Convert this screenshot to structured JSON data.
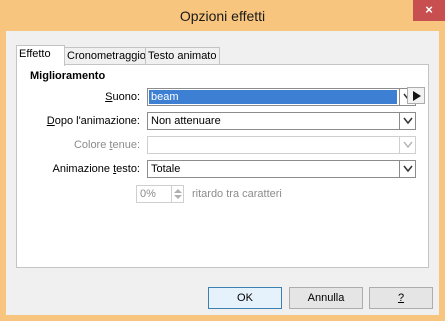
{
  "window": {
    "title": "Opzioni effetti",
    "close_glyph": "×"
  },
  "tabs": [
    {
      "label": "Effetto",
      "active": true
    },
    {
      "label": "Cronometraggio",
      "active": false
    },
    {
      "label": "Testo animato",
      "active": false
    }
  ],
  "section": {
    "title": "Miglioramento"
  },
  "fields": {
    "suono": {
      "label": "Suono:",
      "value": "beam"
    },
    "dopo": {
      "label": "Dopo l'animazione:",
      "value": "Non attenuare"
    },
    "colore": {
      "label": "Colore tenue:",
      "value": ""
    },
    "animazione": {
      "label": "Animazione testo:",
      "value": "Totale"
    },
    "ritardo": {
      "value": "0%",
      "label": "ritardo tra caratteri"
    }
  },
  "buttons": {
    "ok": "OK",
    "annulla": "Annulla",
    "help": "?"
  }
}
